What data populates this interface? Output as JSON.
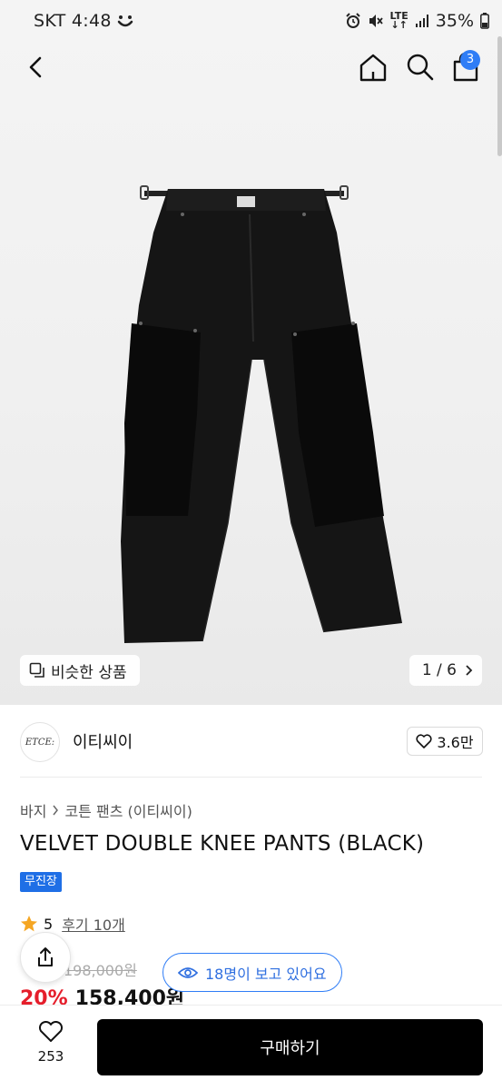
{
  "status_bar": {
    "carrier_time": "SKT 4:48",
    "lte": "LTE",
    "battery": "35%"
  },
  "nav": {
    "cart_count": "3"
  },
  "gallery": {
    "similar_label": "비슷한 상품",
    "page": "1 / 6"
  },
  "brand": {
    "logo_text": "ETCE:",
    "name": "이티씨이",
    "likes": "3.6만"
  },
  "breadcrumb": {
    "category": "바지",
    "subcategory": "코튼 팬츠 (이티씨이)"
  },
  "product": {
    "title": "VELVET DOUBLE KNEE PANTS (BLACK)",
    "badge": "무진장",
    "rating": "5",
    "reviews": "후기 10개",
    "original_price": "198,000원",
    "discount": "20%",
    "price": "158,400원"
  },
  "viewers": {
    "text": "18명이 보고 있어요"
  },
  "bottom": {
    "like_count": "253",
    "buy_label": "구매하기"
  },
  "colors": {
    "accent": "#2f7df6",
    "discount": "#e51e2b",
    "buy_button": "#000000"
  }
}
